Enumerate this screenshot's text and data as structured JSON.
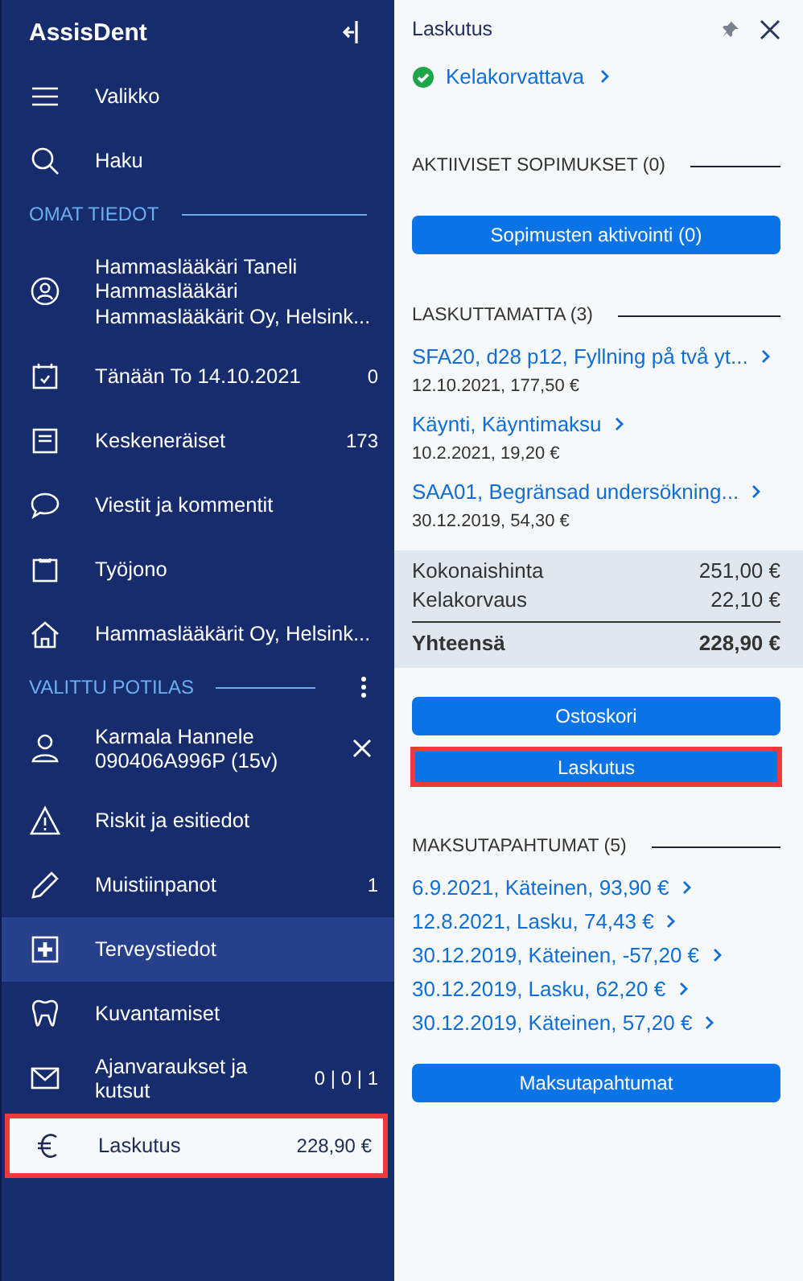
{
  "sidebar": {
    "title": "AssisDent",
    "items": [
      {
        "kind": "link",
        "label": "Valikko",
        "selected": false,
        "hovered": false,
        "highlighted": false
      },
      {
        "kind": "link",
        "label": "Haku",
        "selected": false,
        "hovered": false,
        "highlighted": false
      },
      {
        "kind": "heading",
        "label": "OMAT TIEDOT"
      },
      {
        "kind": "profile",
        "lines": [
          "Hammaslääkäri Taneli",
          "Hammaslääkäri",
          "Hammaslääkärit Oy, Helsink..."
        ],
        "selected": false,
        "hovered": false,
        "highlighted": false
      },
      {
        "kind": "link",
        "label": "Tänään To 14.10.2021",
        "count": "0",
        "selected": false,
        "hovered": false,
        "highlighted": false
      },
      {
        "kind": "link",
        "label": "Keskeneräiset",
        "count": "173",
        "selected": false,
        "hovered": false,
        "highlighted": false
      },
      {
        "kind": "link",
        "label": "Viestit ja kommentit",
        "selected": false,
        "hovered": false,
        "highlighted": false
      },
      {
        "kind": "link",
        "label": "Työjono",
        "selected": false,
        "hovered": false,
        "highlighted": false
      },
      {
        "kind": "link",
        "label": "Hammaslääkärit Oy, Helsink...",
        "selected": false,
        "hovered": false,
        "highlighted": false
      },
      {
        "kind": "heading",
        "label": "VALITTU POTILAS",
        "menu": true
      },
      {
        "kind": "patient",
        "lines": [
          "Karmala Hannele",
          "090406A996P (15v)"
        ],
        "selected": false,
        "hovered": false,
        "highlighted": false
      },
      {
        "kind": "link",
        "label": "Riskit ja esitiedot",
        "selected": false,
        "hovered": false,
        "highlighted": false
      },
      {
        "kind": "link",
        "label": "Muistiinpanot",
        "count": "1",
        "selected": false,
        "hovered": false,
        "highlighted": false
      },
      {
        "kind": "link",
        "label": "Terveystiedot",
        "selected": false,
        "hovered": true,
        "highlighted": false
      },
      {
        "kind": "link",
        "label": "Kuvantamiset",
        "selected": false,
        "hovered": false,
        "highlighted": false
      },
      {
        "kind": "link",
        "label": "Ajanvaraukset ja kutsut",
        "count": "0 | 0 | 1",
        "selected": false,
        "hovered": false,
        "highlighted": false
      },
      {
        "kind": "link",
        "label": "Laskutus",
        "count": "228,90 €",
        "selected": true,
        "hovered": false,
        "highlighted": true
      }
    ]
  },
  "panel": {
    "title": "Laskutus",
    "status": {
      "label": "Kelakorvattava",
      "ok": true
    },
    "contracts": {
      "heading": "AKTIIVISET SOPIMUKSET (0)",
      "button": "Sopimusten aktivointi (0)"
    },
    "unbilled": {
      "heading": "LASKUTTAMATTA (3)",
      "items": [
        {
          "title": "SFA20, d28 p12, Fyllning på två yt...",
          "detail": "12.10.2021, 177,50 €"
        },
        {
          "title": "Käynti, Käyntimaksu",
          "detail": "10.2.2021, 19,20 €"
        },
        {
          "title": "SAA01, Begränsad undersökning...",
          "detail": "30.12.2019, 54,30 €"
        }
      ]
    },
    "totals": [
      {
        "kind": "row",
        "label": "Kokonaishinta",
        "value": "251,00 €"
      },
      {
        "kind": "row",
        "label": "Kelakorvaus",
        "value": "22,10 €"
      },
      {
        "kind": "total",
        "label": "Yhteensä",
        "value": "228,90 €"
      }
    ],
    "buttons": [
      {
        "label": "Ostoskori",
        "highlighted": false
      },
      {
        "label": "Laskutus",
        "highlighted": true
      }
    ],
    "payments": {
      "heading": "MAKSUTAPAHTUMAT (5)",
      "items": [
        "6.9.2021, Käteinen, 93,90 €",
        "12.8.2021, Lasku, 74,43 €",
        "30.12.2019, Käteinen, -57,20 €",
        "30.12.2019, Lasku, 62,20 €",
        "30.12.2019, Käteinen, 57,20 €"
      ],
      "button": "Maksutapahtumat"
    }
  }
}
